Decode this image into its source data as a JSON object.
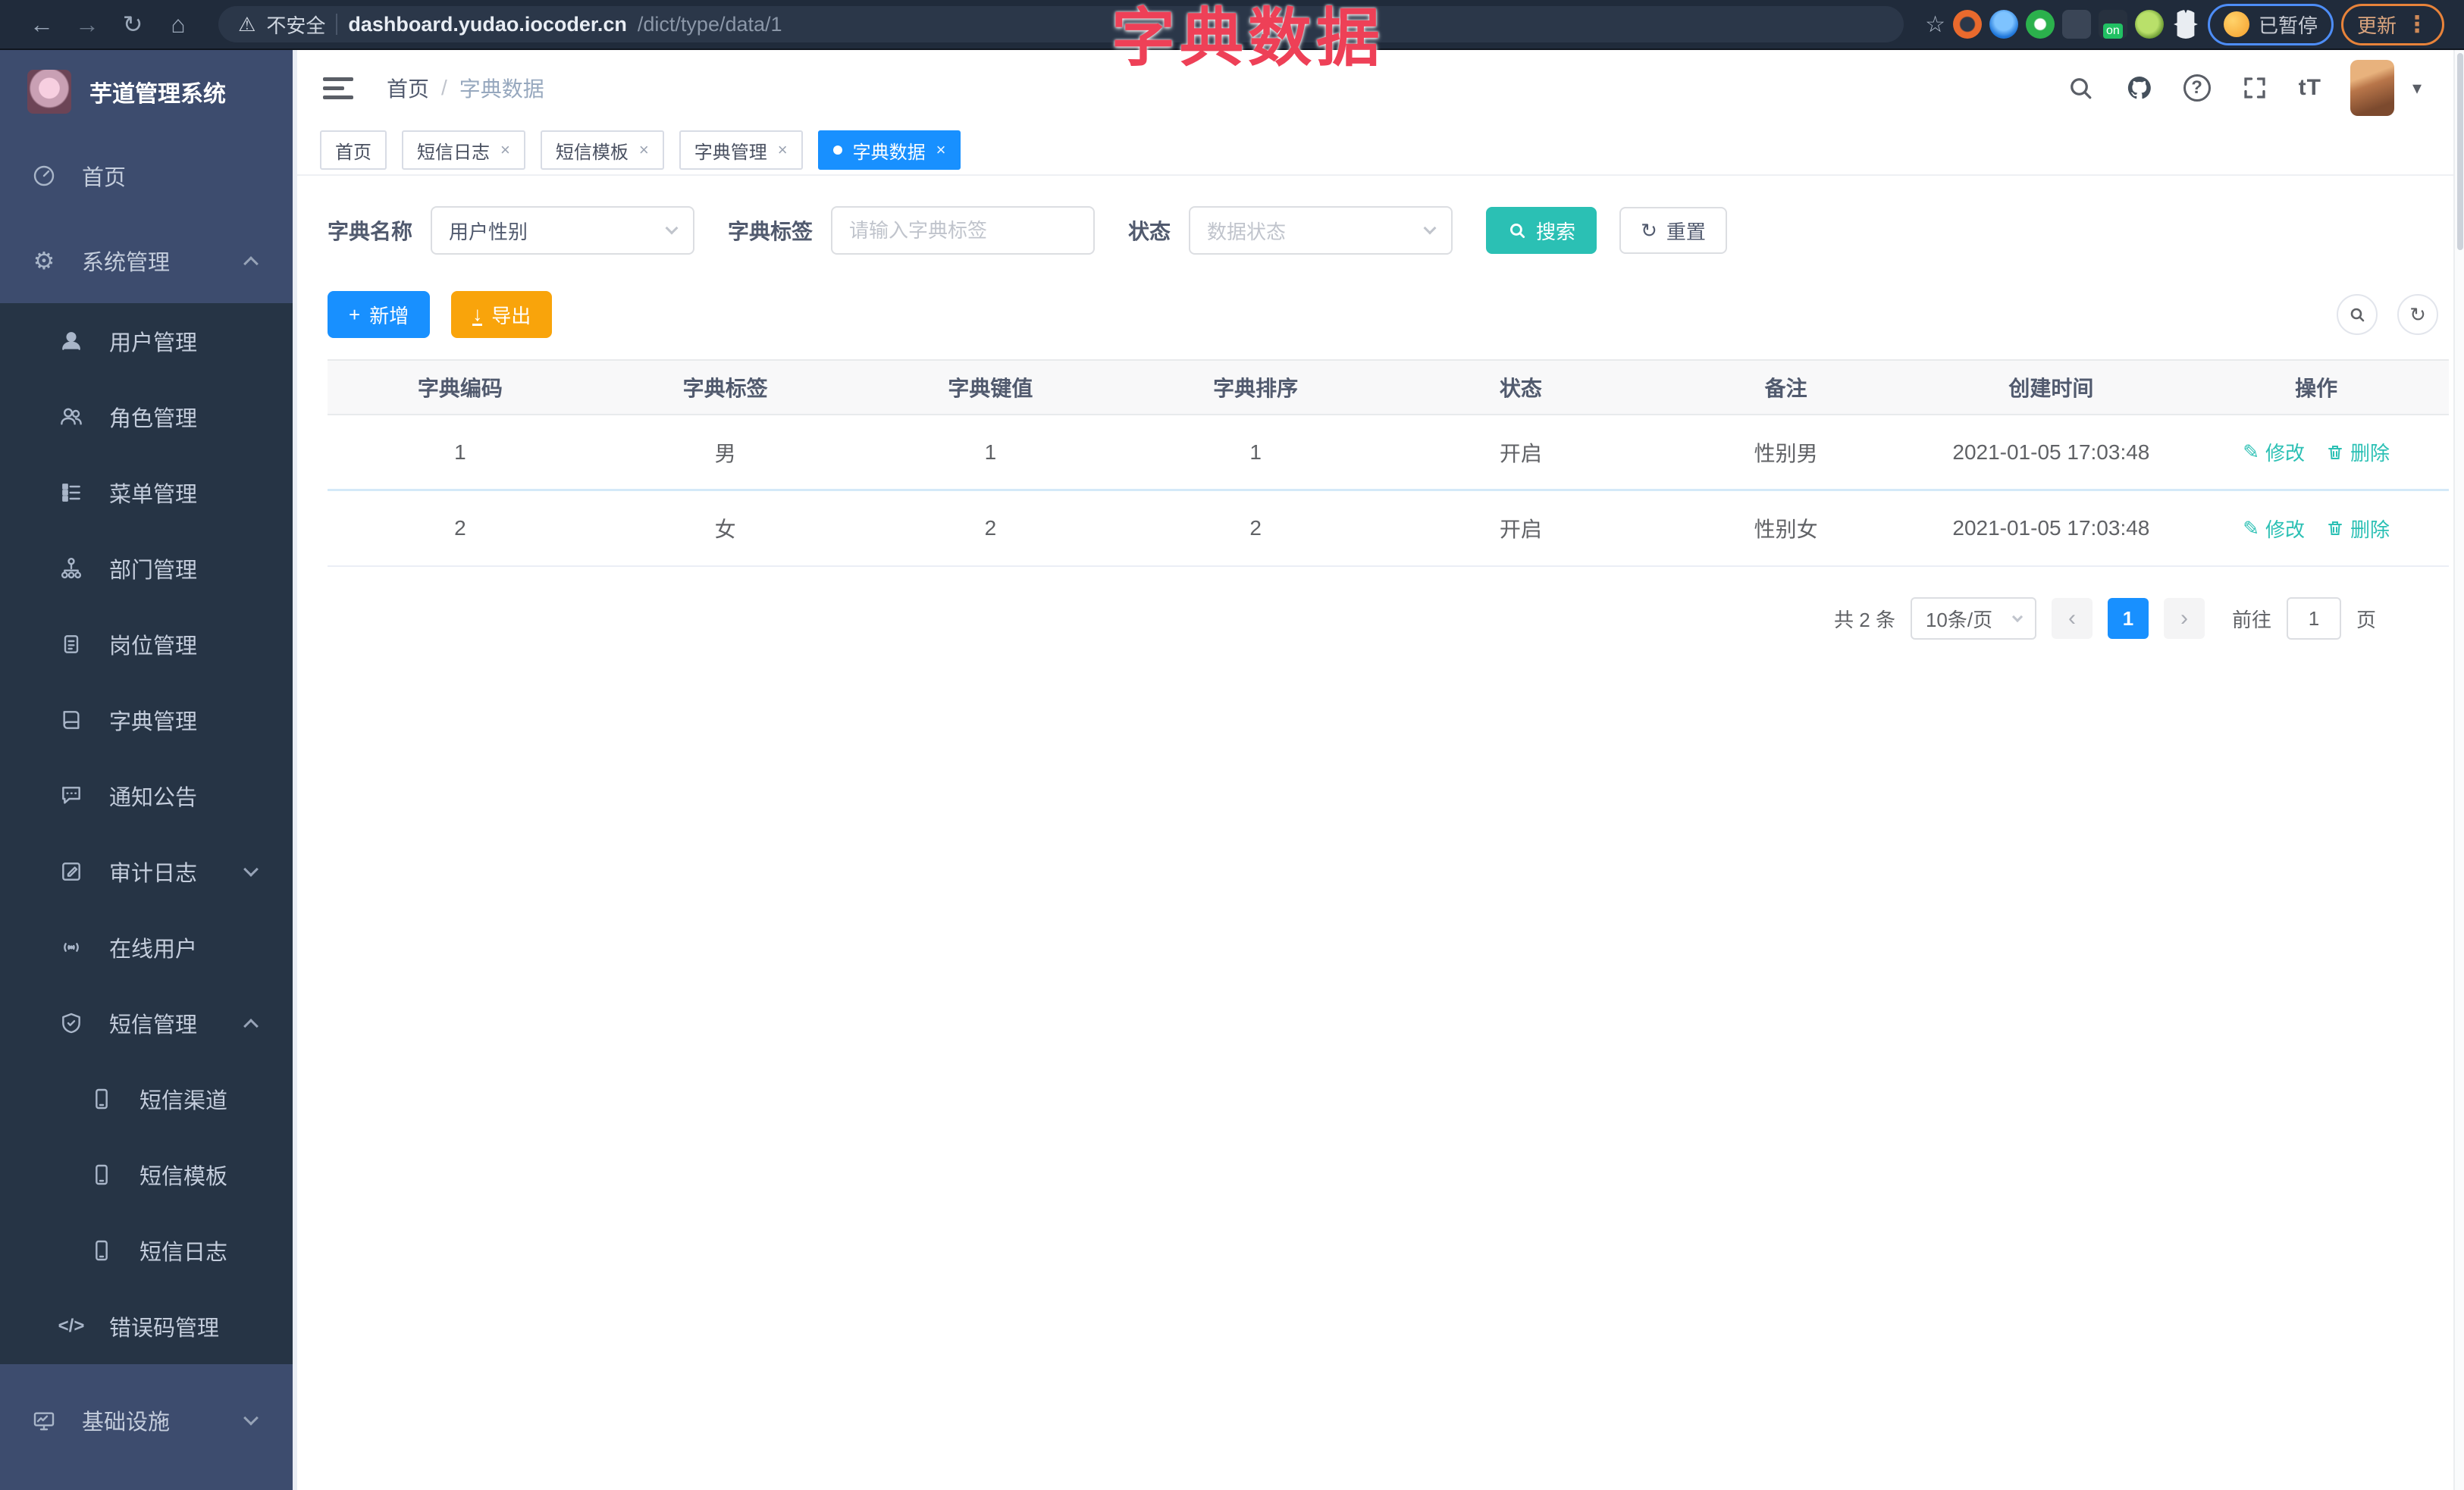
{
  "icons": {
    "back": "←",
    "forward": "→",
    "reload": "↻",
    "home": "⌂",
    "warning": "⚠",
    "star": "☆",
    "dots": "⋮",
    "caret": "▾",
    "question": "?",
    "font_size": "tT",
    "gear": "⚙",
    "code": "</>",
    "plus": "+",
    "download": "↓",
    "refresh": "↻",
    "edit": "✎",
    "prev": "‹",
    "next": "›",
    "slash": "/"
  },
  "browser": {
    "security": "不安全",
    "url_host": "dashboard.yudao.iocoder.cn",
    "url_path": "/dict/type/data/1",
    "paused": "已暂停",
    "update": "更新"
  },
  "overlay": {
    "title": "字典数据"
  },
  "sidebar": {
    "app_title": "芋道管理系统",
    "items": [
      {
        "label": "首页"
      },
      {
        "label": "系统管理"
      },
      {
        "label": "用户管理"
      },
      {
        "label": "角色管理"
      },
      {
        "label": "菜单管理"
      },
      {
        "label": "部门管理"
      },
      {
        "label": "岗位管理"
      },
      {
        "label": "字典管理"
      },
      {
        "label": "通知公告"
      },
      {
        "label": "审计日志"
      },
      {
        "label": "在线用户"
      },
      {
        "label": "短信管理"
      },
      {
        "label": "短信渠道"
      },
      {
        "label": "短信模板"
      },
      {
        "label": "短信日志"
      },
      {
        "label": "错误码管理"
      },
      {
        "label": "基础设施"
      }
    ]
  },
  "breadcrumb": {
    "home": "首页",
    "current": "字典数据"
  },
  "tags": {
    "items": [
      {
        "label": "首页"
      },
      {
        "label": "短信日志"
      },
      {
        "label": "短信模板"
      },
      {
        "label": "字典管理"
      },
      {
        "label": "字典数据"
      }
    ]
  },
  "search": {
    "name_label": "字典名称",
    "name_value": "用户性别",
    "tag_label": "字典标签",
    "tag_placeholder": "请输入字典标签",
    "status_label": "状态",
    "status_placeholder": "数据状态",
    "search_btn": "搜索",
    "reset_btn": "重置"
  },
  "toolbar": {
    "add": "新增",
    "export": "导出"
  },
  "table": {
    "headers": [
      "字典编码",
      "字典标签",
      "字典键值",
      "字典排序",
      "状态",
      "备注",
      "创建时间",
      "操作"
    ],
    "rows": [
      {
        "code": "1",
        "label": "男",
        "value": "1",
        "sort": "1",
        "status": "开启",
        "remark": "性别男",
        "created": "2021-01-05 17:03:48",
        "edit": "修改",
        "delete": "删除"
      },
      {
        "code": "2",
        "label": "女",
        "value": "2",
        "sort": "2",
        "status": "开启",
        "remark": "性别女",
        "created": "2021-01-05 17:03:48",
        "edit": "修改",
        "delete": "删除"
      }
    ]
  },
  "pagination": {
    "total": "共 2 条",
    "page_size": "10条/页",
    "page": "1",
    "goto": "前往",
    "goto_value": "1",
    "unit": "页"
  },
  "colors": {
    "primary": "#1890ff",
    "teal": "#2bc0b4",
    "warning": "#f9a40b",
    "overlay_red": "#ee4057"
  }
}
